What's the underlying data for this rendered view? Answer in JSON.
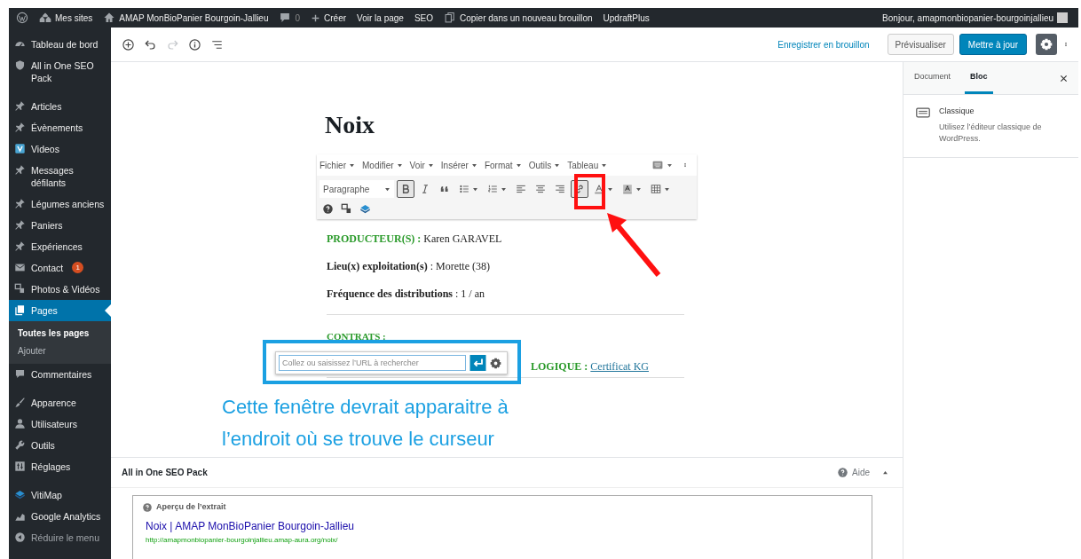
{
  "admin_bar": {
    "items": [
      {
        "kind": "wp"
      },
      {
        "kind": "sites",
        "label": "Mes sites"
      },
      {
        "kind": "home",
        "label": "AMAP MonBioPanier Bourgoin-Jallieu"
      },
      {
        "kind": "comments",
        "label": "0"
      },
      {
        "kind": "plus",
        "label": "Créer"
      },
      {
        "kind": "text",
        "label": "Voir la page"
      },
      {
        "kind": "text",
        "label": "SEO"
      },
      {
        "kind": "copy",
        "label": "Copier dans un nouveau brouillon"
      },
      {
        "kind": "text",
        "label": "UpdraftPlus"
      }
    ],
    "greeting": "Bonjour, amapmonbiopanier-bourgoinjallieu"
  },
  "admin_menu": [
    {
      "label": "Tableau de bord",
      "kind": "dashboard",
      "selected": false
    },
    {
      "label": "All in One SEO Pack",
      "kind": "shield",
      "selected": false
    },
    {
      "label": "Articles",
      "kind": "pin",
      "selected": false
    },
    {
      "label": "Évènements",
      "kind": "pin",
      "selected": false
    },
    {
      "label": "Videos",
      "kind": "video",
      "selected": false
    },
    {
      "label": "Messages défilants",
      "kind": "pin",
      "selected": false
    },
    {
      "label": "Légumes anciens",
      "kind": "pin",
      "selected": false
    },
    {
      "label": "Paniers",
      "kind": "pin",
      "selected": false
    },
    {
      "label": "Expériences",
      "kind": "pin",
      "selected": false
    },
    {
      "label": "Contact",
      "kind": "mail",
      "selected": false,
      "badge": "1"
    },
    {
      "label": "Photos & Vidéos",
      "kind": "photos",
      "selected": false
    },
    {
      "label": "Pages",
      "kind": "pages",
      "selected": true,
      "children": [
        {
          "label": "Toutes les pages",
          "selected": true
        },
        {
          "label": "Ajouter",
          "selected": false
        }
      ]
    },
    {
      "label": "Commentaires",
      "kind": "comment",
      "selected": false
    },
    {
      "label": "Apparence",
      "kind": "brush",
      "selected": false
    },
    {
      "label": "Utilisateurs",
      "kind": "user",
      "selected": false
    },
    {
      "label": "Outils",
      "kind": "wrench",
      "selected": false
    },
    {
      "label": "Réglages",
      "kind": "sliders",
      "selected": false
    },
    {
      "label": "VitiMap",
      "kind": "layer",
      "selected": false
    },
    {
      "label": "Google Analytics",
      "kind": "chart",
      "selected": false
    },
    {
      "label": "Réduire le menu",
      "kind": "collapse",
      "selected": false
    }
  ],
  "editor_header": {
    "tools": [
      {
        "kind": "add",
        "disabled": false
      },
      {
        "kind": "undo",
        "disabled": false
      },
      {
        "kind": "redo",
        "disabled": true
      },
      {
        "kind": "info",
        "disabled": false
      },
      {
        "kind": "outline",
        "disabled": false
      }
    ],
    "save_draft": "Enregistrer en brouillon",
    "preview": "Prévisualiser",
    "update": "Mettre à jour",
    "settings_active": true
  },
  "title": "Noix",
  "classic_toolbar": {
    "menus": [
      "Fichier",
      "Modifier",
      "Voir",
      "Insérer",
      "Format",
      "Outils",
      "Tableau"
    ],
    "buttons": [
      {
        "kind": "format",
        "label": "Paragraphe",
        "pressed": false,
        "menu": true
      },
      {
        "kind": "bold",
        "pressed": true,
        "menu": false
      },
      {
        "kind": "italic",
        "pressed": false,
        "menu": false
      },
      {
        "kind": "quote",
        "pressed": false,
        "menu": false
      },
      {
        "kind": "bullets",
        "pressed": false,
        "menu": true
      },
      {
        "kind": "numbers",
        "pressed": false,
        "menu": true
      },
      {
        "kind": "align-left",
        "pressed": false,
        "menu": false
      },
      {
        "kind": "align-center",
        "pressed": false,
        "menu": false
      },
      {
        "kind": "align-right",
        "pressed": false,
        "menu": false
      },
      {
        "kind": "link",
        "pressed": true,
        "menu": false
      },
      {
        "kind": "text-color",
        "pressed": false,
        "menu": true
      },
      {
        "kind": "bg-color",
        "pressed": false,
        "menu": true
      },
      {
        "kind": "table",
        "pressed": false,
        "menu": true
      }
    ],
    "extra": [
      {
        "kind": "help"
      },
      {
        "kind": "media"
      },
      {
        "kind": "layer"
      }
    ]
  },
  "content": [
    {
      "kind": "field",
      "label": "PRODUCTEUR(S) :",
      "value": " Karen GARAVEL"
    },
    {
      "kind": "detail",
      "label": "Lieu(x) exploitation(s)",
      "value": " : Morette (38)"
    },
    {
      "kind": "detail",
      "label": "Fréquence des distributions",
      "value": " : 1 / an"
    },
    {
      "kind": "rule"
    },
    {
      "kind": "heading",
      "label": "CONTRATS :"
    },
    {
      "kind": "link_line",
      "label": "LOGIQUE :",
      "link": "Certificat KG"
    },
    {
      "kind": "rule"
    }
  ],
  "link_popup": {
    "placeholder": "Collez ou saisissez l’URL à rechercher"
  },
  "annotation": {
    "lines": [
      "Cette fenêtre devrait apparaitre à",
      "l’endroit où se trouve le curseur"
    ]
  },
  "seo_box": {
    "title": "All in One SEO Pack",
    "help": "Aide",
    "preview_title": "Aperçu de l’extrait",
    "snippet_title": "Noix | AMAP MonBioPanier Bourgoin-Jallieu",
    "snippet_url": "http://amapmonbiopanier-bourgoinjallieu.amap-aura.org/noix/"
  },
  "settings_panel": {
    "tabs": [
      {
        "label": "Document",
        "selected": false
      },
      {
        "label": "Bloc",
        "selected": true
      }
    ],
    "block_name": "Classique",
    "block_description": "Utilisez l’éditeur classique de WordPress."
  }
}
